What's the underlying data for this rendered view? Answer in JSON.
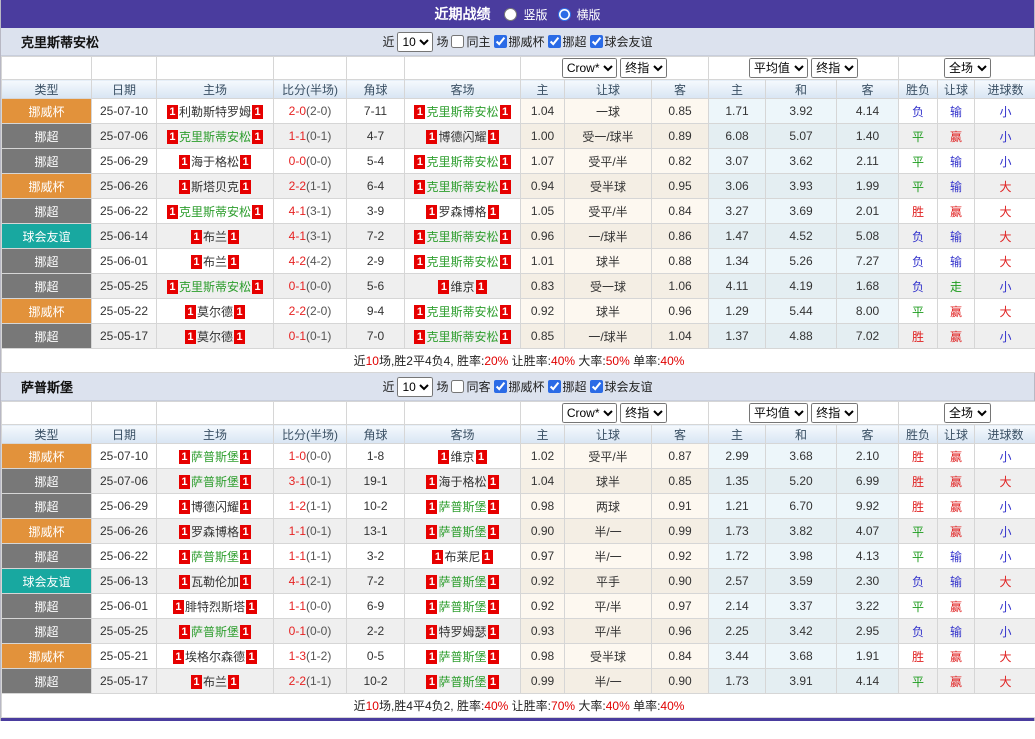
{
  "title_bar": {
    "title": "近期战绩",
    "vertical_label": "竖版",
    "horizontal_label": "横版"
  },
  "badges": {
    "red_card": "1"
  },
  "table_columns": [
    "类型",
    "日期",
    "主场",
    "比分(半场)",
    "角球",
    "客场",
    "主",
    "让球",
    "客",
    "主",
    "和",
    "客",
    "胜负",
    "让球",
    "进球数"
  ],
  "odds_selects": {
    "book": "Crow*",
    "final1": "终指",
    "avg": "平均值",
    "final2": "终指",
    "scope": "全场"
  },
  "colors": {
    "theme_purple": "#4a3c9e",
    "cup_orange": "#e2923b",
    "league_gray": "#787878",
    "friendly_teal": "#18a8a0",
    "team_green": "#2e9e2e",
    "win_red": "#e02222",
    "draw_green": "#1e9c1e",
    "lose_blue": "#3333cc"
  },
  "sections": [
    {
      "team": "克里斯蒂安松",
      "filter": {
        "near": "近",
        "count": "10",
        "games": "场",
        "same": "同主",
        "cup": "挪威杯",
        "league": "挪超",
        "friendly": "球会友谊"
      },
      "rows": [
        {
          "league": "挪威杯",
          "league_type": "cup",
          "date": "25-07-10",
          "home": "利勒斯特罗姆",
          "home_team": false,
          "home_card": "none",
          "score": "2-0",
          "half": "(2-0)",
          "corners": "7-11",
          "away": "克里斯蒂安松",
          "away_team": true,
          "away_card": "none",
          "crow_home": "1.04",
          "handicap": "一球",
          "crow_away": "0.85",
          "avg_home": "1.71",
          "avg_draw": "3.92",
          "avg_away": "4.14",
          "wdl": "负",
          "hcp_res": "输",
          "goal_res": "小"
        },
        {
          "league": "挪超",
          "league_type": "lg",
          "date": "25-07-06",
          "home": "克里斯蒂安松",
          "home_team": true,
          "home_card": "none",
          "score": "1-1",
          "half": "(0-1)",
          "corners": "4-7",
          "away": "博德闪耀",
          "away_team": false,
          "away_card": "after",
          "crow_home": "1.00",
          "handicap": "受一/球半",
          "crow_away": "0.89",
          "avg_home": "6.08",
          "avg_draw": "5.07",
          "avg_away": "1.40",
          "wdl": "平",
          "hcp_res": "赢",
          "goal_res": "小"
        },
        {
          "league": "挪超",
          "league_type": "lg",
          "date": "25-06-29",
          "home": "海于格松",
          "home_team": false,
          "home_card": "none",
          "score": "0-0",
          "half": "(0-0)",
          "corners": "5-4",
          "away": "克里斯蒂安松",
          "away_team": true,
          "away_card": "none",
          "crow_home": "1.07",
          "handicap": "受平/半",
          "crow_away": "0.82",
          "avg_home": "3.07",
          "avg_draw": "3.62",
          "avg_away": "2.11",
          "wdl": "平",
          "hcp_res": "输",
          "goal_res": "小"
        },
        {
          "league": "挪威杯",
          "league_type": "cup",
          "date": "25-06-26",
          "home": "斯塔贝克",
          "home_team": false,
          "home_card": "none",
          "score": "2-2",
          "half": "(1-1)",
          "corners": "6-4",
          "away": "克里斯蒂安松",
          "away_team": true,
          "away_card": "after",
          "crow_home": "0.94",
          "handicap": "受半球",
          "crow_away": "0.95",
          "avg_home": "3.06",
          "avg_draw": "3.93",
          "avg_away": "1.99",
          "wdl": "平",
          "hcp_res": "输",
          "goal_res": "大"
        },
        {
          "league": "挪超",
          "league_type": "lg",
          "date": "25-06-22",
          "home": "克里斯蒂安松",
          "home_team": true,
          "home_card": "none",
          "score": "4-1",
          "half": "(3-1)",
          "corners": "3-9",
          "away": "罗森博格",
          "away_team": false,
          "away_card": "none",
          "crow_home": "1.05",
          "handicap": "受平/半",
          "crow_away": "0.84",
          "avg_home": "3.27",
          "avg_draw": "3.69",
          "avg_away": "2.01",
          "wdl": "胜",
          "hcp_res": "赢",
          "goal_res": "大"
        },
        {
          "league": "球会友谊",
          "league_type": "fr",
          "date": "25-06-14",
          "home": "布兰",
          "home_team": false,
          "home_card": "none",
          "score": "4-1",
          "half": "(3-1)",
          "corners": "7-2",
          "away": "克里斯蒂安松",
          "away_team": true,
          "away_card": "none",
          "crow_home": "0.96",
          "handicap": "一/球半",
          "crow_away": "0.86",
          "avg_home": "1.47",
          "avg_draw": "4.52",
          "avg_away": "5.08",
          "wdl": "负",
          "hcp_res": "输",
          "goal_res": "大"
        },
        {
          "league": "挪超",
          "league_type": "lg",
          "date": "25-06-01",
          "home": "布兰",
          "home_team": false,
          "home_card": "none",
          "score": "4-2",
          "half": "(4-2)",
          "corners": "2-9",
          "away": "克里斯蒂安松",
          "away_team": true,
          "away_card": "none",
          "crow_home": "1.01",
          "handicap": "球半",
          "crow_away": "0.88",
          "avg_home": "1.34",
          "avg_draw": "5.26",
          "avg_away": "7.27",
          "wdl": "负",
          "hcp_res": "输",
          "goal_res": "大"
        },
        {
          "league": "挪超",
          "league_type": "lg",
          "date": "25-05-25",
          "home": "克里斯蒂安松",
          "home_team": true,
          "home_card": "none",
          "score": "0-1",
          "half": "(0-0)",
          "corners": "5-6",
          "away": "维京",
          "away_team": false,
          "away_card": "none",
          "crow_home": "0.83",
          "handicap": "受一球",
          "crow_away": "1.06",
          "avg_home": "4.11",
          "avg_draw": "4.19",
          "avg_away": "1.68",
          "wdl": "负",
          "hcp_res": "走",
          "goal_res": "小"
        },
        {
          "league": "挪威杯",
          "league_type": "cup",
          "date": "25-05-22",
          "home": "莫尔德",
          "home_team": false,
          "home_card": "none",
          "score": "2-2",
          "half": "(2-0)",
          "corners": "9-4",
          "away": "克里斯蒂安松",
          "away_team": true,
          "away_card": "none",
          "crow_home": "0.92",
          "handicap": "球半",
          "crow_away": "0.96",
          "avg_home": "1.29",
          "avg_draw": "5.44",
          "avg_away": "8.00",
          "wdl": "平",
          "hcp_res": "赢",
          "goal_res": "大"
        },
        {
          "league": "挪超",
          "league_type": "lg",
          "date": "25-05-17",
          "home": "莫尔德",
          "home_team": false,
          "home_card": "none",
          "score": "0-1",
          "half": "(0-1)",
          "corners": "7-0",
          "away": "克里斯蒂安松",
          "away_team": true,
          "away_card": "none",
          "crow_home": "0.85",
          "handicap": "一/球半",
          "crow_away": "1.04",
          "avg_home": "1.37",
          "avg_draw": "4.88",
          "avg_away": "7.02",
          "wdl": "胜",
          "hcp_res": "赢",
          "goal_res": "小"
        }
      ],
      "summary": [
        {
          "t": "近",
          "red": false
        },
        {
          "t": "10",
          "red": true
        },
        {
          "t": "场,胜2平4负4, 胜率:",
          "red": false
        },
        {
          "t": "20%",
          "red": true
        },
        {
          "t": " 让胜率:",
          "red": false
        },
        {
          "t": "40%",
          "red": true
        },
        {
          "t": " 大率:",
          "red": false
        },
        {
          "t": "50%",
          "red": true
        },
        {
          "t": " 单率:",
          "red": false
        },
        {
          "t": "40%",
          "red": true
        }
      ]
    },
    {
      "team": "萨普斯堡",
      "filter": {
        "near": "近",
        "count": "10",
        "games": "场",
        "same": "同客",
        "cup": "挪威杯",
        "league": "挪超",
        "friendly": "球会友谊"
      },
      "rows": [
        {
          "league": "挪威杯",
          "league_type": "cup",
          "date": "25-07-10",
          "home": "萨普斯堡",
          "home_team": true,
          "home_card": "none",
          "score": "1-0",
          "half": "(0-0)",
          "corners": "1-8",
          "away": "维京",
          "away_team": false,
          "away_card": "none",
          "crow_home": "1.02",
          "handicap": "受平/半",
          "crow_away": "0.87",
          "avg_home": "2.99",
          "avg_draw": "3.68",
          "avg_away": "2.10",
          "wdl": "胜",
          "hcp_res": "赢",
          "goal_res": "小"
        },
        {
          "league": "挪超",
          "league_type": "lg",
          "date": "25-07-06",
          "home": "萨普斯堡",
          "home_team": true,
          "home_card": "none",
          "score": "3-1",
          "half": "(0-1)",
          "corners": "19-1",
          "away": "海于格松",
          "away_team": false,
          "away_card": "none",
          "crow_home": "1.04",
          "handicap": "球半",
          "crow_away": "0.85",
          "avg_home": "1.35",
          "avg_draw": "5.20",
          "avg_away": "6.99",
          "wdl": "胜",
          "hcp_res": "赢",
          "goal_res": "大"
        },
        {
          "league": "挪超",
          "league_type": "lg",
          "date": "25-06-29",
          "home": "博德闪耀",
          "home_team": false,
          "home_card": "none",
          "score": "1-2",
          "half": "(1-1)",
          "corners": "10-2",
          "away": "萨普斯堡",
          "away_team": true,
          "away_card": "none",
          "crow_home": "0.98",
          "handicap": "两球",
          "crow_away": "0.91",
          "avg_home": "1.21",
          "avg_draw": "6.70",
          "avg_away": "9.92",
          "wdl": "胜",
          "hcp_res": "赢",
          "goal_res": "小"
        },
        {
          "league": "挪威杯",
          "league_type": "cup",
          "date": "25-06-26",
          "home": "罗森博格",
          "home_team": false,
          "home_card": "none",
          "score": "1-1",
          "half": "(0-1)",
          "corners": "13-1",
          "away": "萨普斯堡",
          "away_team": true,
          "away_card": "none",
          "crow_home": "0.90",
          "handicap": "半/一",
          "crow_away": "0.99",
          "avg_home": "1.73",
          "avg_draw": "3.82",
          "avg_away": "4.07",
          "wdl": "平",
          "hcp_res": "赢",
          "goal_res": "小"
        },
        {
          "league": "挪超",
          "league_type": "lg",
          "date": "25-06-22",
          "home": "萨普斯堡",
          "home_team": true,
          "home_card": "none",
          "score": "1-1",
          "half": "(1-1)",
          "corners": "3-2",
          "away": "布莱尼",
          "away_team": false,
          "away_card": "none",
          "crow_home": "0.97",
          "handicap": "半/一",
          "crow_away": "0.92",
          "avg_home": "1.72",
          "avg_draw": "3.98",
          "avg_away": "4.13",
          "wdl": "平",
          "hcp_res": "输",
          "goal_res": "小"
        },
        {
          "league": "球会友谊",
          "league_type": "fr",
          "date": "25-06-13",
          "home": "瓦勒伦加",
          "home_team": false,
          "home_card": "none",
          "score": "4-1",
          "half": "(2-1)",
          "corners": "7-2",
          "away": "萨普斯堡",
          "away_team": true,
          "away_card": "none",
          "crow_home": "0.92",
          "handicap": "平手",
          "crow_away": "0.90",
          "avg_home": "2.57",
          "avg_draw": "3.59",
          "avg_away": "2.30",
          "wdl": "负",
          "hcp_res": "输",
          "goal_res": "大"
        },
        {
          "league": "挪超",
          "league_type": "lg",
          "date": "25-06-01",
          "home": "腓特烈斯塔",
          "home_team": false,
          "home_card": "none",
          "score": "1-1",
          "half": "(0-0)",
          "corners": "6-9",
          "away": "萨普斯堡",
          "away_team": true,
          "away_card": "none",
          "crow_home": "0.92",
          "handicap": "平/半",
          "crow_away": "0.97",
          "avg_home": "2.14",
          "avg_draw": "3.37",
          "avg_away": "3.22",
          "wdl": "平",
          "hcp_res": "赢",
          "goal_res": "小"
        },
        {
          "league": "挪超",
          "league_type": "lg",
          "date": "25-05-25",
          "home": "萨普斯堡",
          "home_team": true,
          "home_card": "none",
          "score": "0-1",
          "half": "(0-0)",
          "corners": "2-2",
          "away": "特罗姆瑟",
          "away_team": false,
          "away_card": "none",
          "crow_home": "0.93",
          "handicap": "平/半",
          "crow_away": "0.96",
          "avg_home": "2.25",
          "avg_draw": "3.42",
          "avg_away": "2.95",
          "wdl": "负",
          "hcp_res": "输",
          "goal_res": "小"
        },
        {
          "league": "挪威杯",
          "league_type": "cup",
          "date": "25-05-21",
          "home": "埃格尔森德",
          "home_team": false,
          "home_card": "before",
          "score": "1-3",
          "half": "(1-2)",
          "corners": "0-5",
          "away": "萨普斯堡",
          "away_team": true,
          "away_card": "none",
          "crow_home": "0.98",
          "handicap": "受半球",
          "crow_away": "0.84",
          "avg_home": "3.44",
          "avg_draw": "3.68",
          "avg_away": "1.91",
          "wdl": "胜",
          "hcp_res": "赢",
          "goal_res": "大"
        },
        {
          "league": "挪超",
          "league_type": "lg",
          "date": "25-05-17",
          "home": "布兰",
          "home_team": false,
          "home_card": "none",
          "score": "2-2",
          "half": "(1-1)",
          "corners": "10-2",
          "away": "萨普斯堡",
          "away_team": true,
          "away_card": "none",
          "crow_home": "0.99",
          "handicap": "半/一",
          "crow_away": "0.90",
          "avg_home": "1.73",
          "avg_draw": "3.91",
          "avg_away": "4.14",
          "wdl": "平",
          "hcp_res": "赢",
          "goal_res": "大"
        }
      ],
      "summary": [
        {
          "t": "近",
          "red": false
        },
        {
          "t": "10",
          "red": true
        },
        {
          "t": "场,胜4平4负2, 胜率:",
          "red": false
        },
        {
          "t": "40%",
          "red": true
        },
        {
          "t": " 让胜率:",
          "red": false
        },
        {
          "t": "70%",
          "red": true
        },
        {
          "t": " 大率:",
          "red": false
        },
        {
          "t": "40%",
          "red": true
        },
        {
          "t": " 单率:",
          "red": false
        },
        {
          "t": "40%",
          "red": true
        }
      ]
    }
  ]
}
